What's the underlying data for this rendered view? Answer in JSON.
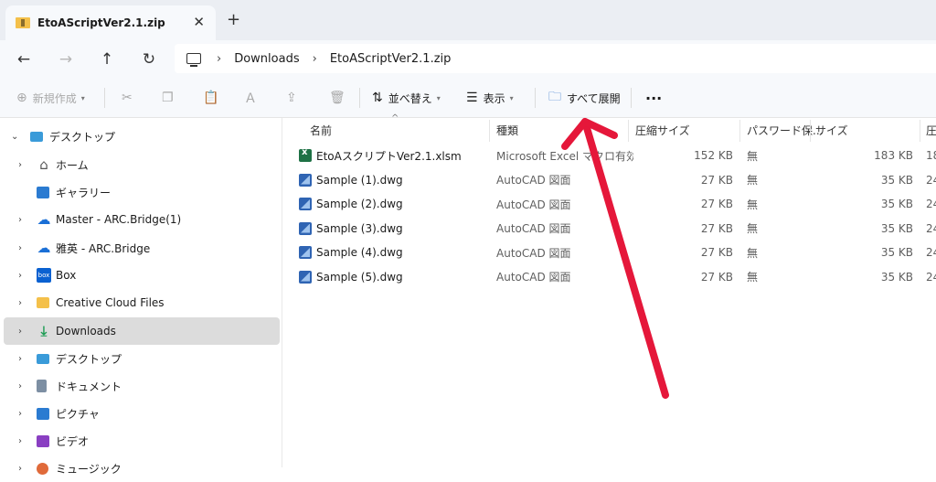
{
  "window": {
    "tab_title": "EtoAScriptVer2.1.zip",
    "tab_close": "✕",
    "new_tab": "+"
  },
  "nav": {
    "back": "←",
    "forward": "→",
    "up": "↑",
    "refresh": "↻",
    "breadcrumb": [
      "Downloads",
      "EtoAScriptVer2.1.zip"
    ],
    "sep": "›"
  },
  "toolbar": {
    "new_label": "新規作成",
    "sort_label": "並べ替え",
    "view_label": "表示",
    "extract_all_label": "すべて展開",
    "more": "···"
  },
  "sidebar": {
    "items": [
      {
        "label": "デスクトップ",
        "icon": "desktop-icon",
        "expanded": true
      },
      {
        "label": "ホーム",
        "icon": "home-icon"
      },
      {
        "label": "ギャラリー",
        "icon": "gallery-icon"
      },
      {
        "label": "Master - ARC.Bridge(1)",
        "icon": "onedrive-icon"
      },
      {
        "label": "雅英 - ARC.Bridge",
        "icon": "onedrive-icon"
      },
      {
        "label": "Box",
        "icon": "box-icon"
      },
      {
        "label": "Creative Cloud Files",
        "icon": "creative-cloud-folder-icon"
      },
      {
        "label": "Downloads",
        "icon": "downloads-icon",
        "selected": true
      },
      {
        "label": "デスクトップ",
        "icon": "desktop-icon"
      },
      {
        "label": "ドキュメント",
        "icon": "documents-icon"
      },
      {
        "label": "ピクチャ",
        "icon": "pictures-icon"
      },
      {
        "label": "ビデオ",
        "icon": "videos-icon"
      },
      {
        "label": "ミュージック",
        "icon": "music-icon"
      }
    ],
    "box_text": "box"
  },
  "files": {
    "columns": [
      "名前",
      "種類",
      "圧縮サイズ",
      "パスワード保...",
      "サイズ",
      "圧"
    ],
    "rows": [
      {
        "name": "EtoAスクリプトVer2.1.xlsm",
        "type": "Microsoft Excel マクロ有効...",
        "compressed": "152 KB",
        "password": "無",
        "size": "183 KB",
        "ratio": "18",
        "icon": "excel"
      },
      {
        "name": "Sample (1).dwg",
        "type": "AutoCAD 図面",
        "compressed": "27 KB",
        "password": "無",
        "size": "35 KB",
        "ratio": "24",
        "icon": "dwg"
      },
      {
        "name": "Sample (2).dwg",
        "type": "AutoCAD 図面",
        "compressed": "27 KB",
        "password": "無",
        "size": "35 KB",
        "ratio": "24",
        "icon": "dwg"
      },
      {
        "name": "Sample (3).dwg",
        "type": "AutoCAD 図面",
        "compressed": "27 KB",
        "password": "無",
        "size": "35 KB",
        "ratio": "24",
        "icon": "dwg"
      },
      {
        "name": "Sample (4).dwg",
        "type": "AutoCAD 図面",
        "compressed": "27 KB",
        "password": "無",
        "size": "35 KB",
        "ratio": "24",
        "icon": "dwg"
      },
      {
        "name": "Sample (5).dwg",
        "type": "AutoCAD 図面",
        "compressed": "27 KB",
        "password": "無",
        "size": "35 KB",
        "ratio": "24",
        "icon": "dwg"
      }
    ]
  },
  "colors": {
    "annotation_arrow": "#e5173a",
    "selected_bg": "#dcdcdc"
  }
}
